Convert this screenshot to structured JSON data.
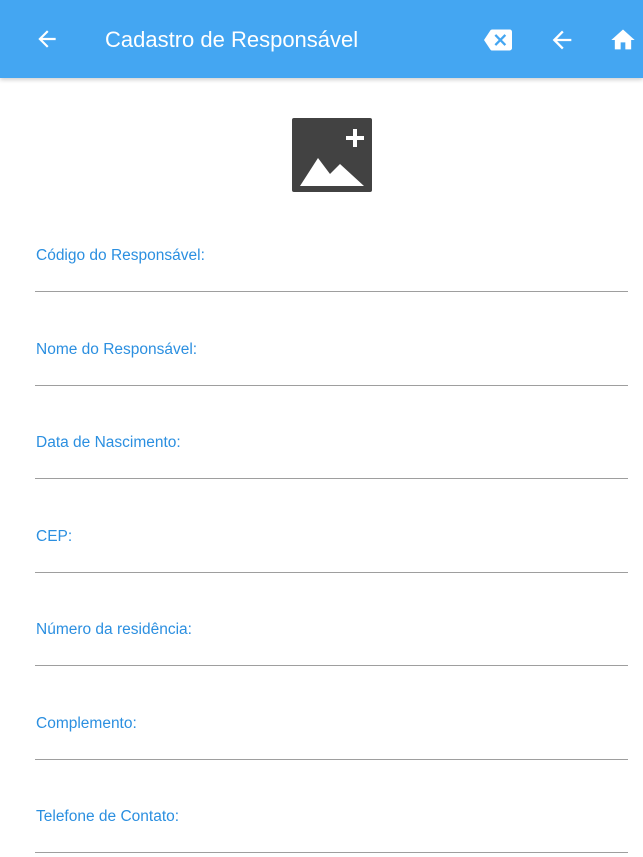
{
  "appbar": {
    "title": "Cadastro de Responsável",
    "icons": [
      "arrow-left-icon",
      "backspace-clear-icon",
      "arrow-left-icon",
      "home-icon"
    ],
    "background": "#44a6f2"
  },
  "photo": {
    "icon": "add-photo-icon",
    "color": "#424242"
  },
  "form": {
    "accent_color": "#2b8fe0",
    "fields": [
      {
        "label": "Código do Responsável:",
        "value": ""
      },
      {
        "label": "Nome do Responsável:",
        "value": ""
      },
      {
        "label": "Data de Nascimento:",
        "value": ""
      },
      {
        "label": "CEP:",
        "value": ""
      },
      {
        "label": "Número da residência:",
        "value": ""
      },
      {
        "label": "Complemento:",
        "value": ""
      },
      {
        "label": "Telefone de Contato:",
        "value": ""
      }
    ]
  }
}
